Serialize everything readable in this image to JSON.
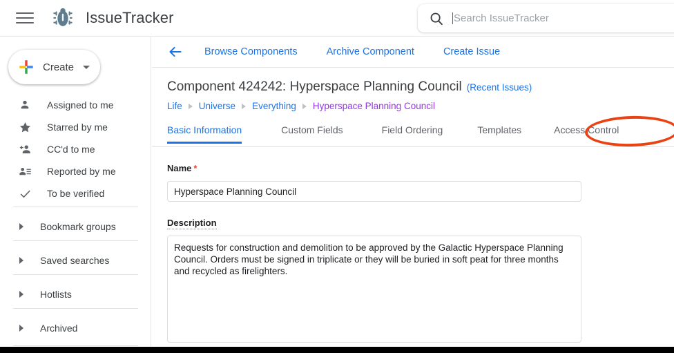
{
  "header": {
    "menu_icon": "hamburger-menu-icon",
    "logo_icon": "bug-logo-icon",
    "brand": "IssueTracker",
    "search": {
      "icon": "search-icon",
      "placeholder": "Search IssueTracker",
      "value": ""
    }
  },
  "sidebar": {
    "create": {
      "label": "Create",
      "icon": "google-plus-icon",
      "caret_icon": "chevron-down-icon"
    },
    "items": [
      {
        "label": "Assigned to me",
        "icon": "person-icon"
      },
      {
        "label": "Starred by me",
        "icon": "star-icon"
      },
      {
        "label": "CC'd to me",
        "icon": "person-add-icon"
      },
      {
        "label": "Reported by me",
        "icon": "person-list-icon"
      },
      {
        "label": "To be verified",
        "icon": "check-icon"
      }
    ],
    "sections": [
      {
        "label": "Bookmark groups",
        "icon": "triangle-right-icon"
      },
      {
        "label": "Saved searches",
        "icon": "triangle-right-icon"
      },
      {
        "label": "Hotlists",
        "icon": "triangle-right-icon"
      },
      {
        "label": "Archived",
        "icon": "triangle-right-icon"
      }
    ]
  },
  "main": {
    "back_icon": "back-arrow-icon",
    "actions": [
      {
        "label": "Browse Components"
      },
      {
        "label": "Archive Component"
      },
      {
        "label": "Create Issue"
      }
    ],
    "title": "Component 424242: Hyperspace Planning Council",
    "recent_issues_link": "(Recent Issues)",
    "breadcrumb": [
      {
        "label": "Life",
        "current": false
      },
      {
        "label": "Universe",
        "current": false
      },
      {
        "label": "Everything",
        "current": false
      },
      {
        "label": "Hyperspace Planning Council",
        "current": true
      }
    ],
    "tabs": [
      {
        "label": "Basic Information",
        "active": true
      },
      {
        "label": "Custom Fields",
        "active": false
      },
      {
        "label": "Field Ordering",
        "active": false
      },
      {
        "label": "Templates",
        "active": false
      },
      {
        "label": "Access Control",
        "active": false
      }
    ],
    "annotation": {
      "shape": "ellipse",
      "target": "Access Control",
      "color": "#ea4313"
    },
    "form": {
      "name": {
        "label": "Name",
        "required_marker": "*",
        "value": "Hyperspace Planning Council",
        "placeholder": ""
      },
      "description": {
        "label": "Description",
        "value": "Requests for construction and demolition to be approved by the Galactic Hyperspace Planning Council. Orders must be signed in triplicate or they will be buried in soft peat for three months and recycled as firelighters.",
        "placeholder": ""
      }
    }
  },
  "colors": {
    "accent_blue": "#1a73e8",
    "visited_purple": "#9334e6",
    "annotation_orange": "#ea4313",
    "required_red": "#ea4335"
  }
}
